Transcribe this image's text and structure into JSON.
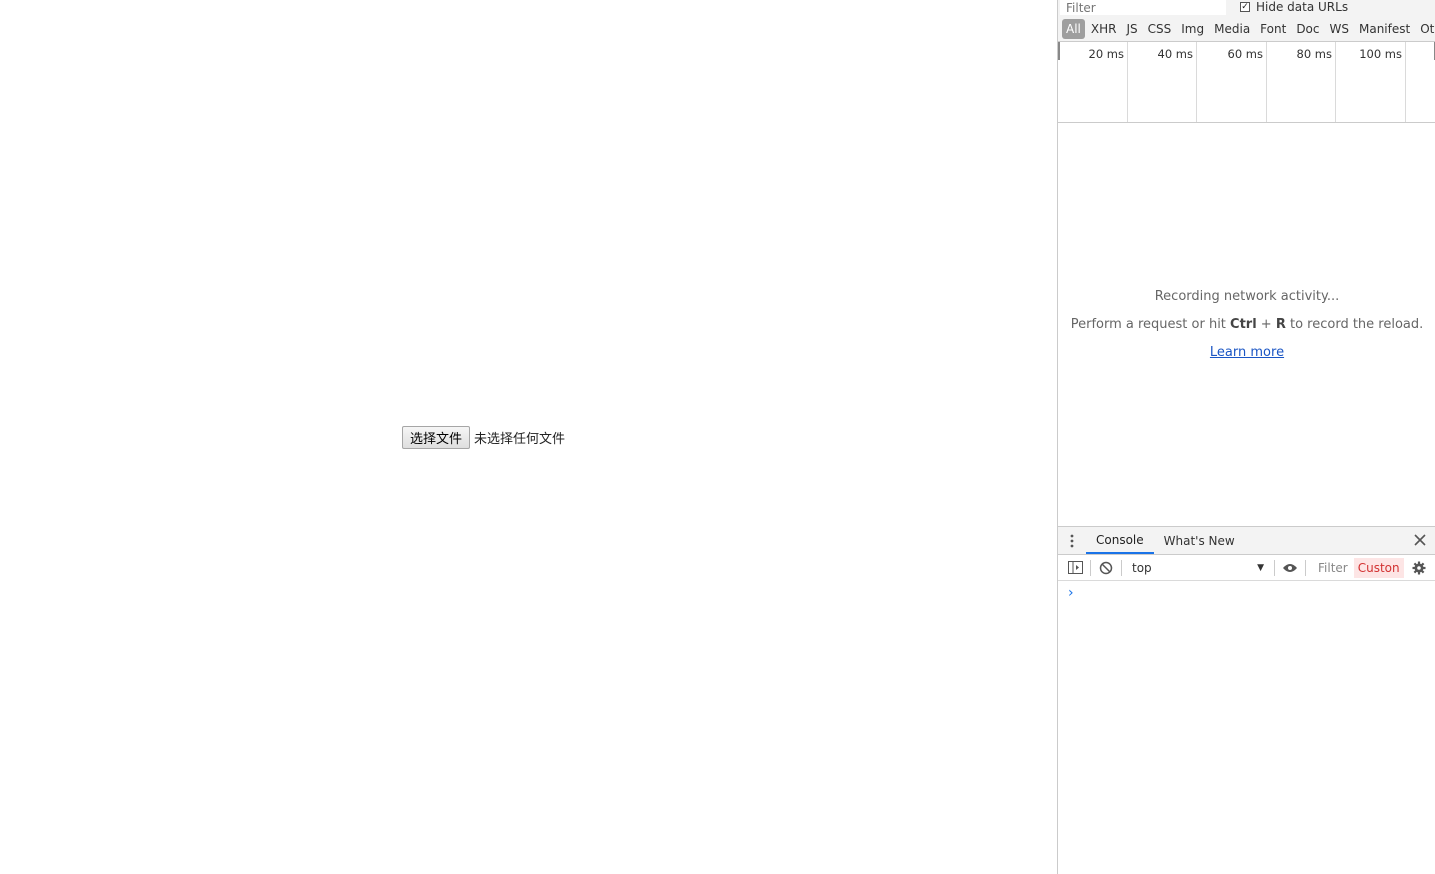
{
  "page": {
    "file_button_label": "选择文件",
    "file_status": "未选择任何文件"
  },
  "network": {
    "filter_placeholder": "Filter",
    "hide_data_urls_label": "Hide data URLs",
    "hide_data_urls_checked": true,
    "types": [
      "All",
      "XHR",
      "JS",
      "CSS",
      "Img",
      "Media",
      "Font",
      "Doc",
      "WS",
      "Manifest",
      "Other"
    ],
    "timeline_ticks": [
      "20 ms",
      "40 ms",
      "60 ms",
      "80 ms",
      "100 ms"
    ],
    "empty_title": "Recording network activity...",
    "empty_hint_prefix": "Perform a request or hit ",
    "empty_hint_key1": "Ctrl",
    "empty_hint_plus": " + ",
    "empty_hint_key2": "R",
    "empty_hint_suffix": " to record the reload.",
    "learn_more": "Learn more"
  },
  "drawer": {
    "tabs": [
      "Console",
      "What's New"
    ],
    "context": "top",
    "filter_label": "Filter",
    "levels_label": "Custon",
    "prompt": "›"
  },
  "colors": {
    "accent": "#1a73e8",
    "link": "#1a55c4",
    "levels_text": "#d23131"
  },
  "icons": [
    "more-vertical-icon",
    "close-icon",
    "sidebar-toggle-icon",
    "clear-console-icon",
    "eye-icon",
    "gear-icon"
  ]
}
